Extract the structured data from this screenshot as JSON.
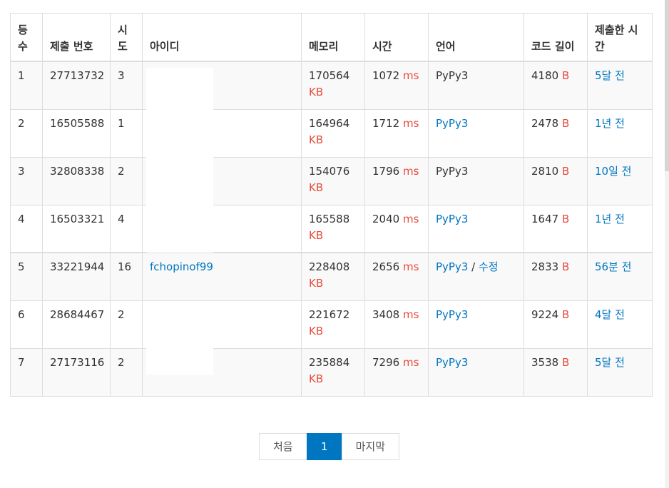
{
  "table": {
    "headers": [
      "등수",
      "제출 번호",
      "시도",
      "아이디",
      "메모리",
      "시간",
      "언어",
      "코드 길이",
      "제출한 시간"
    ],
    "rows": [
      {
        "rank": "1",
        "submission": "27713732",
        "tries": "3",
        "user": "",
        "memory": "170564",
        "memory_unit": "KB",
        "time": "1072",
        "time_unit": "ms",
        "language": "PyPy3",
        "edit": "",
        "length": "4180",
        "length_unit": "B",
        "submitted": "5달 전"
      },
      {
        "rank": "2",
        "submission": "16505588",
        "tries": "1",
        "user": "",
        "memory": "164964",
        "memory_unit": "KB",
        "time": "1712",
        "time_unit": "ms",
        "language": "PyPy3",
        "edit": "",
        "length": "2478",
        "length_unit": "B",
        "submitted": "1년 전"
      },
      {
        "rank": "3",
        "submission": "32808338",
        "tries": "2",
        "user": "",
        "memory": "154076",
        "memory_unit": "KB",
        "time": "1796",
        "time_unit": "ms",
        "language": "PyPy3",
        "edit": "",
        "length": "2810",
        "length_unit": "B",
        "submitted": "10일 전"
      },
      {
        "rank": "4",
        "submission": "16503321",
        "tries": "4",
        "user": "",
        "memory": "165588",
        "memory_unit": "KB",
        "time": "2040",
        "time_unit": "ms",
        "language": "PyPy3",
        "edit": "",
        "length": "1647",
        "length_unit": "B",
        "submitted": "1년 전"
      },
      {
        "rank": "5",
        "submission": "33221944",
        "tries": "16",
        "user": "fchopinof99",
        "memory": "228408",
        "memory_unit": "KB",
        "time": "2656",
        "time_unit": "ms",
        "language": "PyPy3",
        "edit": "수정",
        "length": "2833",
        "length_unit": "B",
        "submitted": "56분 전"
      },
      {
        "rank": "6",
        "submission": "28684467",
        "tries": "2",
        "user": "",
        "memory": "221672",
        "memory_unit": "KB",
        "time": "3408",
        "time_unit": "ms",
        "language": "PyPy3",
        "edit": "",
        "length": "9224",
        "length_unit": "B",
        "submitted": "4달 전"
      },
      {
        "rank": "7",
        "submission": "27173116",
        "tries": "2",
        "user": "",
        "memory": "235884",
        "memory_unit": "KB",
        "time": "7296",
        "time_unit": "ms",
        "language": "PyPy3",
        "edit": "",
        "length": "3538",
        "length_unit": "B",
        "submitted": "5달 전"
      }
    ]
  },
  "pagination": {
    "first": "처음",
    "current": "1",
    "last": "마지막"
  },
  "colors": {
    "link": "#0076c0",
    "unit": "#e74c3c",
    "active_page": "#0076c0"
  }
}
